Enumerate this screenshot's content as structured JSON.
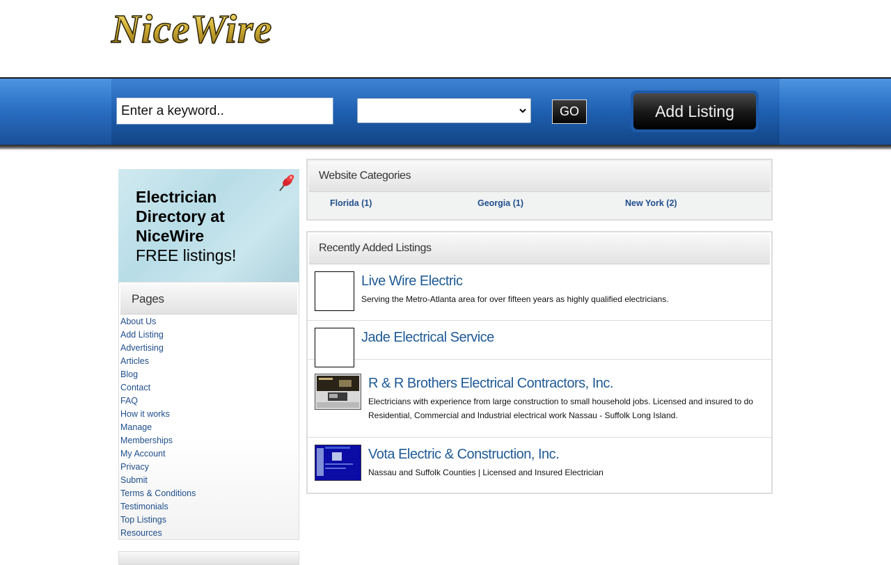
{
  "header": {
    "logo_text": "NiceWire"
  },
  "search": {
    "keyword_value": "Enter a keyword..",
    "select_value": "",
    "go_label": "GO",
    "add_listing_label": "Add Listing"
  },
  "promo": {
    "line1": "Electrician",
    "line2": "Directory at",
    "line3": "NiceWire",
    "line4": "FREE listings!"
  },
  "pages": {
    "title": "Pages",
    "items": [
      {
        "label": "About Us"
      },
      {
        "label": "Add Listing"
      },
      {
        "label": "Advertising"
      },
      {
        "label": "Articles"
      },
      {
        "label": "Blog"
      },
      {
        "label": "Contact"
      },
      {
        "label": "FAQ"
      },
      {
        "label": "How it works"
      },
      {
        "label": "Manage"
      },
      {
        "label": "Memberships"
      },
      {
        "label": "My Account"
      },
      {
        "label": "Privacy"
      },
      {
        "label": "Submit"
      },
      {
        "label": "Terms & Conditions"
      },
      {
        "label": "Testimonials"
      },
      {
        "label": "Top Listings"
      },
      {
        "label": "Resources"
      }
    ]
  },
  "categories": {
    "title": "Website Categories",
    "items": [
      {
        "label": "Florida (1)"
      },
      {
        "label": "Georgia (1)"
      },
      {
        "label": "New York (2)"
      }
    ]
  },
  "recent": {
    "title": "Recently Added Listings",
    "items": [
      {
        "title": "Live Wire Electric",
        "desc": "Serving the Metro-Atlanta area for over fifteen years as highly qualified electricians."
      },
      {
        "title": "Jade Electrical Service",
        "desc": ""
      },
      {
        "title": "R & R Brothers Electrical Contractors, Inc.",
        "desc": "Electricians with experience from large construction to small household jobs. Licensed and insured to do Residential, Commercial and Industrial electrical work Nassau - Suffolk Long Island."
      },
      {
        "title": "Vota Electric & Construction, Inc.",
        "desc": "Nassau and Suffolk Counties | Licensed and Insured Electrician"
      }
    ]
  },
  "colors": {
    "link": "#1f4e8c",
    "bar_blue": "#2a6fc3",
    "logo_gold": "#c9a92a"
  }
}
